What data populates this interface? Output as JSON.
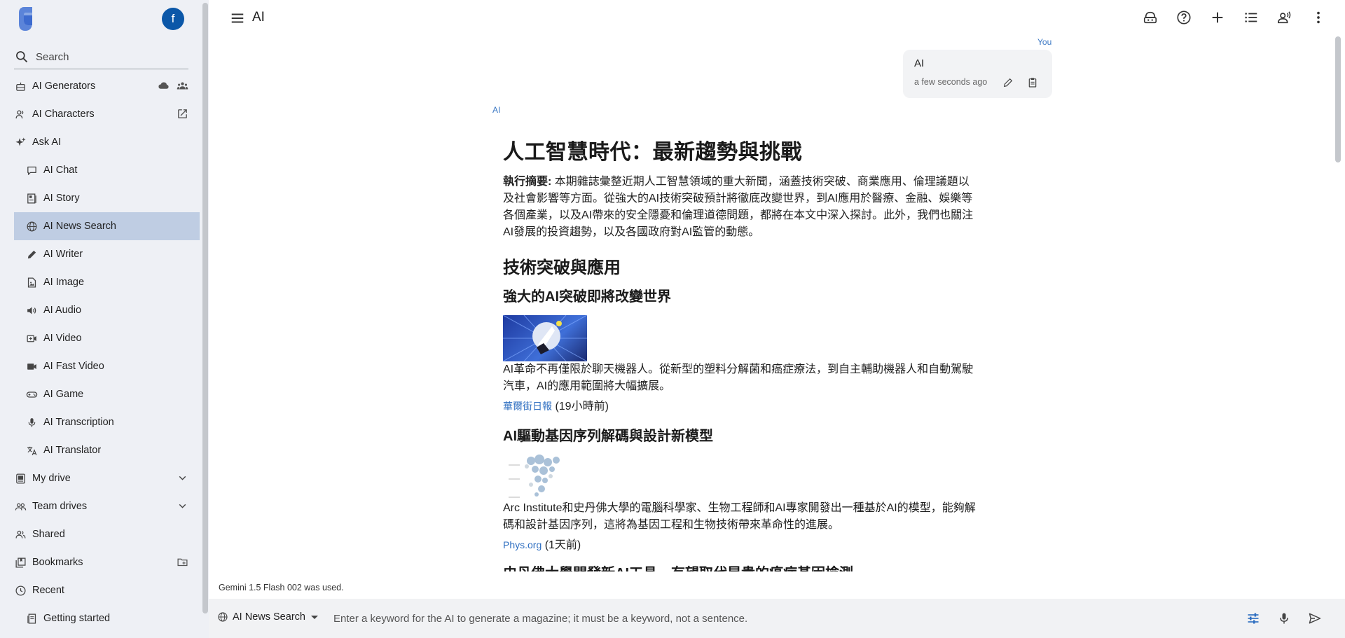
{
  "sidebar": {
    "avatar_letter": "f",
    "search_placeholder": "Search",
    "items": [
      {
        "label": "AI Generators"
      },
      {
        "label": "AI Characters"
      },
      {
        "label": "Ask AI"
      },
      {
        "label": "AI Chat"
      },
      {
        "label": "AI Story"
      },
      {
        "label": "AI News Search"
      },
      {
        "label": "AI Writer"
      },
      {
        "label": "AI Image"
      },
      {
        "label": "AI Audio"
      },
      {
        "label": "AI Video"
      },
      {
        "label": "AI Fast Video"
      },
      {
        "label": "AI Game"
      },
      {
        "label": "AI Transcription"
      },
      {
        "label": "AI Translator"
      },
      {
        "label": "My drive"
      },
      {
        "label": "Team drives"
      },
      {
        "label": "Shared"
      },
      {
        "label": "Bookmarks"
      },
      {
        "label": "Recent"
      },
      {
        "label": "Getting started"
      }
    ]
  },
  "header": {
    "title": "AI"
  },
  "chat": {
    "user_label": "You",
    "user_message": "AI",
    "user_time": "a few seconds ago",
    "ai_label": "AI",
    "article": {
      "title": "人工智慧時代：最新趨勢與挑戰",
      "summary_label": "執行摘要:",
      "summary_text": " 本期雜誌彙整近期人工智慧領域的重大新聞，涵蓋技術突破、商業應用、倫理議題以及社會影響等方面。從強大的AI技術突破預計將徹底改變世界，到AI應用於醫療、金融、娛樂等各個產業，以及AI帶來的安全隱憂和倫理道德問題，都將在本文中深入探討。此外，我們也關注AI發展的投資趨勢，以及各國政府對AI監管的動態。",
      "section1": "技術突破與應用",
      "story1_title": "強大的AI突破即將改變世界",
      "story1_text": "AI革命不再僅限於聊天機器人。從新型的塑料分解菌和癌症療法，到自主輔助機器人和自動駕駛汽車，AI的應用範圍將大幅擴展。",
      "story1_source": "華爾街日報",
      "story1_time": " (19小時前)",
      "story2_title": "AI驅動基因序列解碼與設計新模型",
      "story2_text": "Arc Institute和史丹佛大學的電腦科學家、生物工程師和AI專家開發出一種基於AI的模型，能夠解碼和設計基因序列，這將為基因工程和生物技術帶來革命性的進展。",
      "story2_source": "Phys.org",
      "story2_time": " (1天前)",
      "story3_title": "史丹佛大學開發新AI工具，有望取代昂貴的癌症基因檢測"
    },
    "model_used": "Gemini 1.5 Flash 002 was used."
  },
  "composer": {
    "mode": "AI News Search",
    "placeholder": "Enter a keyword for the AI to generate a magazine; it must be a keyword, not a sentence."
  },
  "colors": {
    "sidebar_bg": "#eef0f5",
    "active_item": "#bfcde3",
    "accent": "#3b78c4",
    "avatar": "#0b57a8"
  }
}
